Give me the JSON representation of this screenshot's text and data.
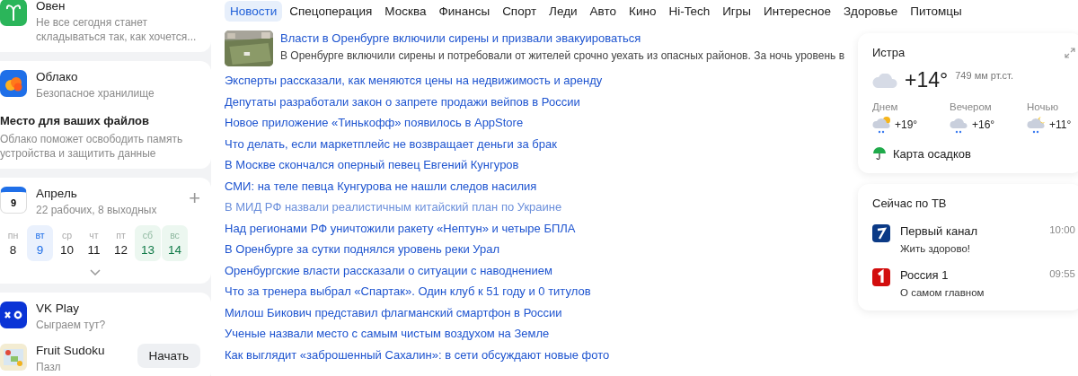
{
  "horoscope": {
    "title": "Овен",
    "text": "Не все сегодня станет складываться так, как хочется..."
  },
  "cloud": {
    "title": "Облако",
    "subtitle": "Безопасное хранилище",
    "heading": "Место для ваших файлов",
    "text": "Облако поможет освободить память устройства и защитить данные"
  },
  "calendar": {
    "date": "9",
    "month": "Апрель",
    "summary": "22 рабочих, 8 выходных",
    "plus": "+",
    "days": [
      {
        "weekday": "пн",
        "day": "8",
        "selected": false,
        "weekend": false
      },
      {
        "weekday": "вт",
        "day": "9",
        "selected": true,
        "weekend": false
      },
      {
        "weekday": "ср",
        "day": "10",
        "selected": false,
        "weekend": false
      },
      {
        "weekday": "чт",
        "day": "11",
        "selected": false,
        "weekend": false
      },
      {
        "weekday": "пт",
        "day": "12",
        "selected": false,
        "weekend": false
      },
      {
        "weekday": "сб",
        "day": "13",
        "selected": false,
        "weekend": true
      },
      {
        "weekday": "вс",
        "day": "14",
        "selected": false,
        "weekend": true
      }
    ]
  },
  "games": {
    "title": "VK Play",
    "subtitle": "Сыграем тут?",
    "items": [
      {
        "title": "Fruit Sudoku",
        "genre": "Пазл",
        "button": "Начать"
      }
    ]
  },
  "tabs": [
    {
      "label": "Новости",
      "selected": true
    },
    {
      "label": "Спецоперация",
      "selected": false
    },
    {
      "label": "Москва",
      "selected": false
    },
    {
      "label": "Финансы",
      "selected": false
    },
    {
      "label": "Спорт",
      "selected": false
    },
    {
      "label": "Леди",
      "selected": false
    },
    {
      "label": "Авто",
      "selected": false
    },
    {
      "label": "Кино",
      "selected": false
    },
    {
      "label": "Hi-Tech",
      "selected": false
    },
    {
      "label": "Игры",
      "selected": false
    },
    {
      "label": "Интересное",
      "selected": false
    },
    {
      "label": "Здоровье",
      "selected": false
    },
    {
      "label": "Питомцы",
      "selected": false
    }
  ],
  "news": [
    {
      "kind": "featured",
      "title": "Власти в Оренбурге включили сирены и призвали эвакуироваться",
      "summary": "В Оренбурге включили сирены и потребовали от жителей срочно уехать из опасных районов. За ночь уровень в",
      "visited": false
    },
    {
      "kind": "link",
      "title": "Эксперты рассказали, как меняются цены на недвижимость и аренду",
      "visited": false
    },
    {
      "kind": "link",
      "title": "Депутаты разработали закон о запрете продажи вейпов в России",
      "visited": false
    },
    {
      "kind": "link",
      "title": "Новое приложение «Тинькофф» появилось в AppStore",
      "visited": false
    },
    {
      "kind": "link",
      "title": "Что делать, если маркетплейс не возвращает деньги за брак",
      "visited": false
    },
    {
      "kind": "link",
      "title": "В Москве скончался оперный певец Евгений Кунгуров",
      "visited": false
    },
    {
      "kind": "link",
      "title": "СМИ: на теле певца Кунгурова не нашли следов насилия",
      "visited": false
    },
    {
      "kind": "link",
      "title": "В МИД РФ назвали реалистичным китайский план по Украине",
      "visited": true
    },
    {
      "kind": "link",
      "title": "Над регионами РФ уничтожили ракету «Нептун» и четыре БПЛА",
      "visited": false
    },
    {
      "kind": "link",
      "title": "В Оренбурге за сутки поднялся уровень реки Урал",
      "visited": false
    },
    {
      "kind": "link",
      "title": "Оренбургские власти рассказали о ситуации с наводнением",
      "visited": false
    },
    {
      "kind": "link",
      "title": "Что за тренера выбрал «Спартак». Один клуб к 51 году и 0 титулов",
      "visited": false
    },
    {
      "kind": "link",
      "title": "Милош Бикович представил флагманский смартфон в России",
      "visited": false
    },
    {
      "kind": "link",
      "title": "Ученые назвали место с самым чистым воздухом на Земле",
      "visited": false
    },
    {
      "kind": "link",
      "title": "Как выглядит «заброшенный Сахалин»: в сети обсуждают новые фото",
      "visited": false
    }
  ],
  "weather": {
    "city": "Истра",
    "temperature": "+14°",
    "pressure": "749 мм рт.ст.",
    "forecast": [
      {
        "period": "Днем",
        "temperature": "+19°",
        "kind": "day"
      },
      {
        "period": "Вечером",
        "temperature": "+16°",
        "kind": "evening"
      },
      {
        "period": "Ночью",
        "temperature": "+11°",
        "kind": "night"
      }
    ],
    "map_link": "Карта осадков"
  },
  "tv": {
    "title": "Сейчас по ТВ",
    "channels": [
      {
        "name": "Первый канал",
        "show": "Жить здорово!",
        "time": "10:00",
        "kind": "first"
      },
      {
        "name": "Россия 1",
        "show": "О самом главном",
        "time": "09:55",
        "kind": "russia"
      }
    ]
  }
}
